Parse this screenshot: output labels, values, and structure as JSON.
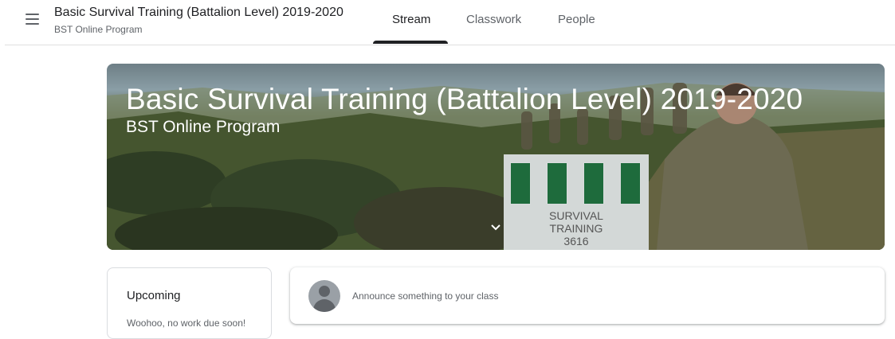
{
  "header": {
    "course_title": "Basic Survival Training (Battalion Level) 2019-2020",
    "course_section": "BST Online Program",
    "tabs": [
      {
        "label": "Stream",
        "active": true
      },
      {
        "label": "Classwork",
        "active": false
      },
      {
        "label": "People",
        "active": false
      }
    ],
    "menu_icon": "hamburger-menu-icon"
  },
  "banner": {
    "title": "Basic Survival Training (Battalion Level) 2019-2020",
    "subtitle": "BST Online Program",
    "sign_lines": [
      "SURVIVAL",
      "TRAINING",
      "3616"
    ],
    "expand_icon": "chevron-down-icon",
    "stripe_color": "#1e6b3c"
  },
  "upcoming": {
    "title": "Upcoming",
    "text": "Woohoo, no work due soon!"
  },
  "announce": {
    "placeholder": "Announce something to your class",
    "avatar_icon": "default-avatar-icon"
  }
}
